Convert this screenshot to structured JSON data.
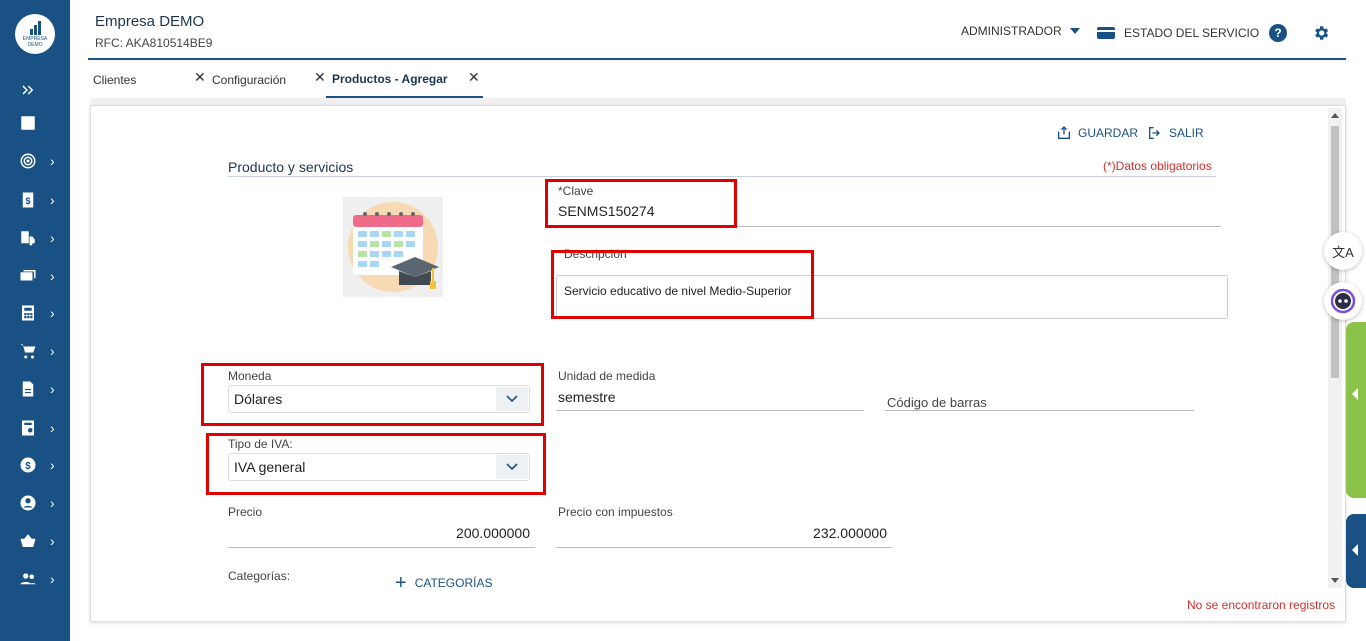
{
  "sidebar": {
    "logo_text": "EMPRESA DEMO",
    "items": [
      {
        "icon": "double-chevron-right-icon",
        "expandable": false
      },
      {
        "icon": "dashboard-icon",
        "expandable": false
      },
      {
        "icon": "target-icon",
        "expandable": true
      },
      {
        "icon": "invoice-dollar-icon",
        "expandable": true
      },
      {
        "icon": "truck-document-icon",
        "expandable": true
      },
      {
        "icon": "money-icon",
        "expandable": true
      },
      {
        "icon": "calculator-icon",
        "expandable": true
      },
      {
        "icon": "cart-icon",
        "expandable": true
      },
      {
        "icon": "document-icon",
        "expandable": true
      },
      {
        "icon": "receipt-icon",
        "expandable": true
      },
      {
        "icon": "dollar-circle-icon",
        "expandable": true
      },
      {
        "icon": "account-circle-icon",
        "expandable": true
      },
      {
        "icon": "basket-icon",
        "expandable": true
      },
      {
        "icon": "people-icon",
        "expandable": true
      }
    ]
  },
  "header": {
    "company": "Empresa DEMO",
    "rfc": "RFC: AKA810514BE9",
    "user": "ADMINISTRADOR",
    "service_status": "ESTADO DEL SERVICIO"
  },
  "tabs": [
    {
      "label": "Clientes",
      "active": false
    },
    {
      "label": "Configuración",
      "active": false
    },
    {
      "label": "Productos - Agregar",
      "active": true
    }
  ],
  "toolbar": {
    "save_label": "GUARDAR",
    "exit_label": "SALIR"
  },
  "form": {
    "section_title": "Producto y servicios",
    "required_note": "(*)Datos obligatorios",
    "clave_label": "*Clave",
    "clave_value": "SENMS150274",
    "descripcion_label": "Descripción",
    "descripcion_value": "Servicio educativo de nivel Medio-Superior",
    "moneda_label": "Moneda",
    "moneda_value": "Dólares",
    "unidad_label": "Unidad de medida",
    "unidad_value": "semestre",
    "codigo_label": "Código de barras",
    "codigo_value": "",
    "iva_label": "Tipo de IVA:",
    "iva_value": "IVA general",
    "precio_label": "Precio",
    "precio_value": "200.000000",
    "precio_imp_label": "Precio con impuestos",
    "precio_imp_value": "232.000000",
    "categorias_label": "Categorías:",
    "categorias_button": "CATEGORÍAS"
  },
  "status": {
    "no_records": "No se encontraron registros"
  },
  "widgets": {
    "translate_label": "文A"
  },
  "colors": {
    "primary": "#1a5185",
    "highlight": "#e00000",
    "error_text": "#d0302c",
    "green_tab": "#8bc34a"
  }
}
